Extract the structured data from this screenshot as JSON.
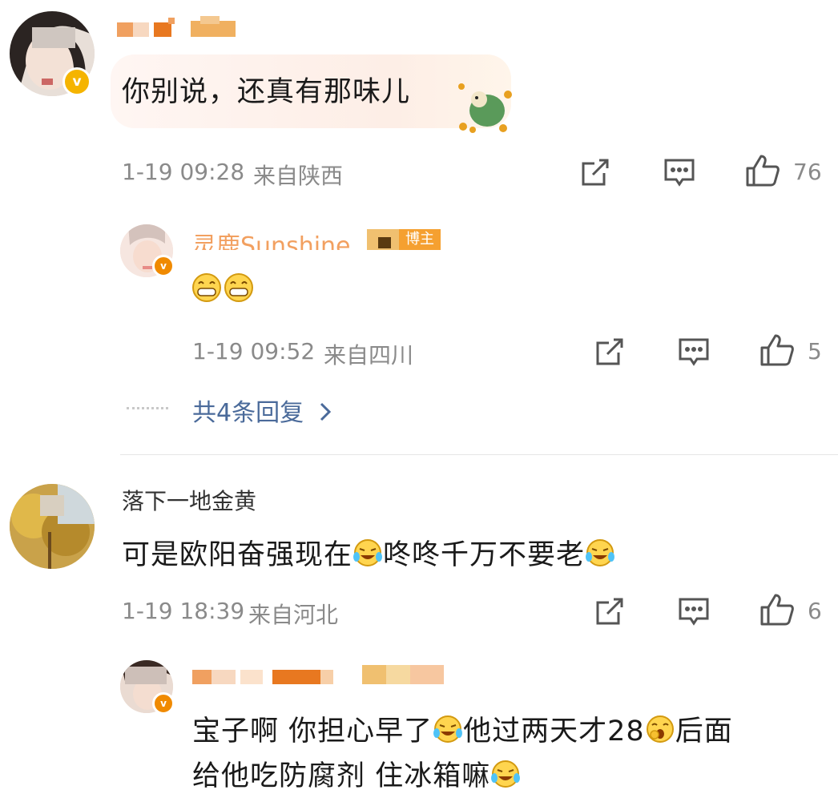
{
  "comments": [
    {
      "text": "你别说，还真有那味儿",
      "time": "1-19 09:28",
      "location": "来自陕西",
      "likes": "76",
      "reply": {
        "name": "灵鹿Sunshine",
        "badge": "博主",
        "text": "",
        "time": "1-19 09:52",
        "location": "来自四川",
        "likes": "5"
      },
      "more_replies": "共4条回复"
    },
    {
      "name": "落下一地金黄",
      "text_a": "可是欧阳奋强现在",
      "text_b": "咚咚千万不要老",
      "time": "1-19 18:39",
      "location": "来自河北",
      "likes": "6",
      "reply": {
        "line1_a": "宝子啊 你担心早了",
        "line1_b": "他过两天才28",
        "line1_c": "后面",
        "line2": "给他吃防腐剂 住冰箱嘛"
      }
    }
  ],
  "icons": {
    "share": "share-icon",
    "comment": "comment-icon",
    "like": "like-icon",
    "badge": "verified-v-icon"
  },
  "colors": {
    "accent_link": "#4a6a9a",
    "meta": "#8a8a8a",
    "verified": "#f5b400"
  }
}
